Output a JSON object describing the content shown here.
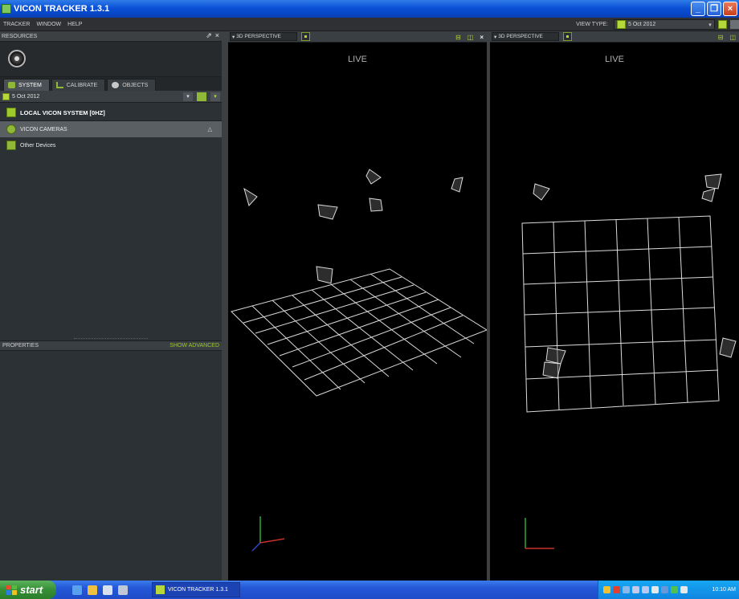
{
  "window": {
    "title": "VICON TRACKER 1.3.1"
  },
  "menu": [
    "TRACKER",
    "WINDOW",
    "HELP"
  ],
  "view_type": {
    "label": "VIEW TYPE:",
    "value": "5 Oct 2012"
  },
  "resources": {
    "header": "RESOURCES",
    "tabs": [
      "SYSTEM",
      "CALIBRATE",
      "OBJECTS"
    ],
    "date": "5 Oct 2012",
    "root": "LOCAL VICON SYSTEM [0Hz]",
    "items": [
      "VICON CAMERAS",
      "Other Devices"
    ]
  },
  "properties": {
    "header": "PROPERTIES",
    "advanced": "SHOW ADVANCED"
  },
  "viewports": [
    {
      "mode": "3D PERSPECTIVE",
      "live": "LIVE"
    },
    {
      "mode": "3D PERSPECTIVE",
      "live": "LIVE"
    }
  ],
  "taskbar": {
    "start": "start",
    "task": "VICON TRACKER 1.3.1",
    "clock": "10:10 AM"
  },
  "colors": {
    "accent": "#b7d83a",
    "panel": "#2c3135",
    "titlebar": "#0a50d6"
  }
}
